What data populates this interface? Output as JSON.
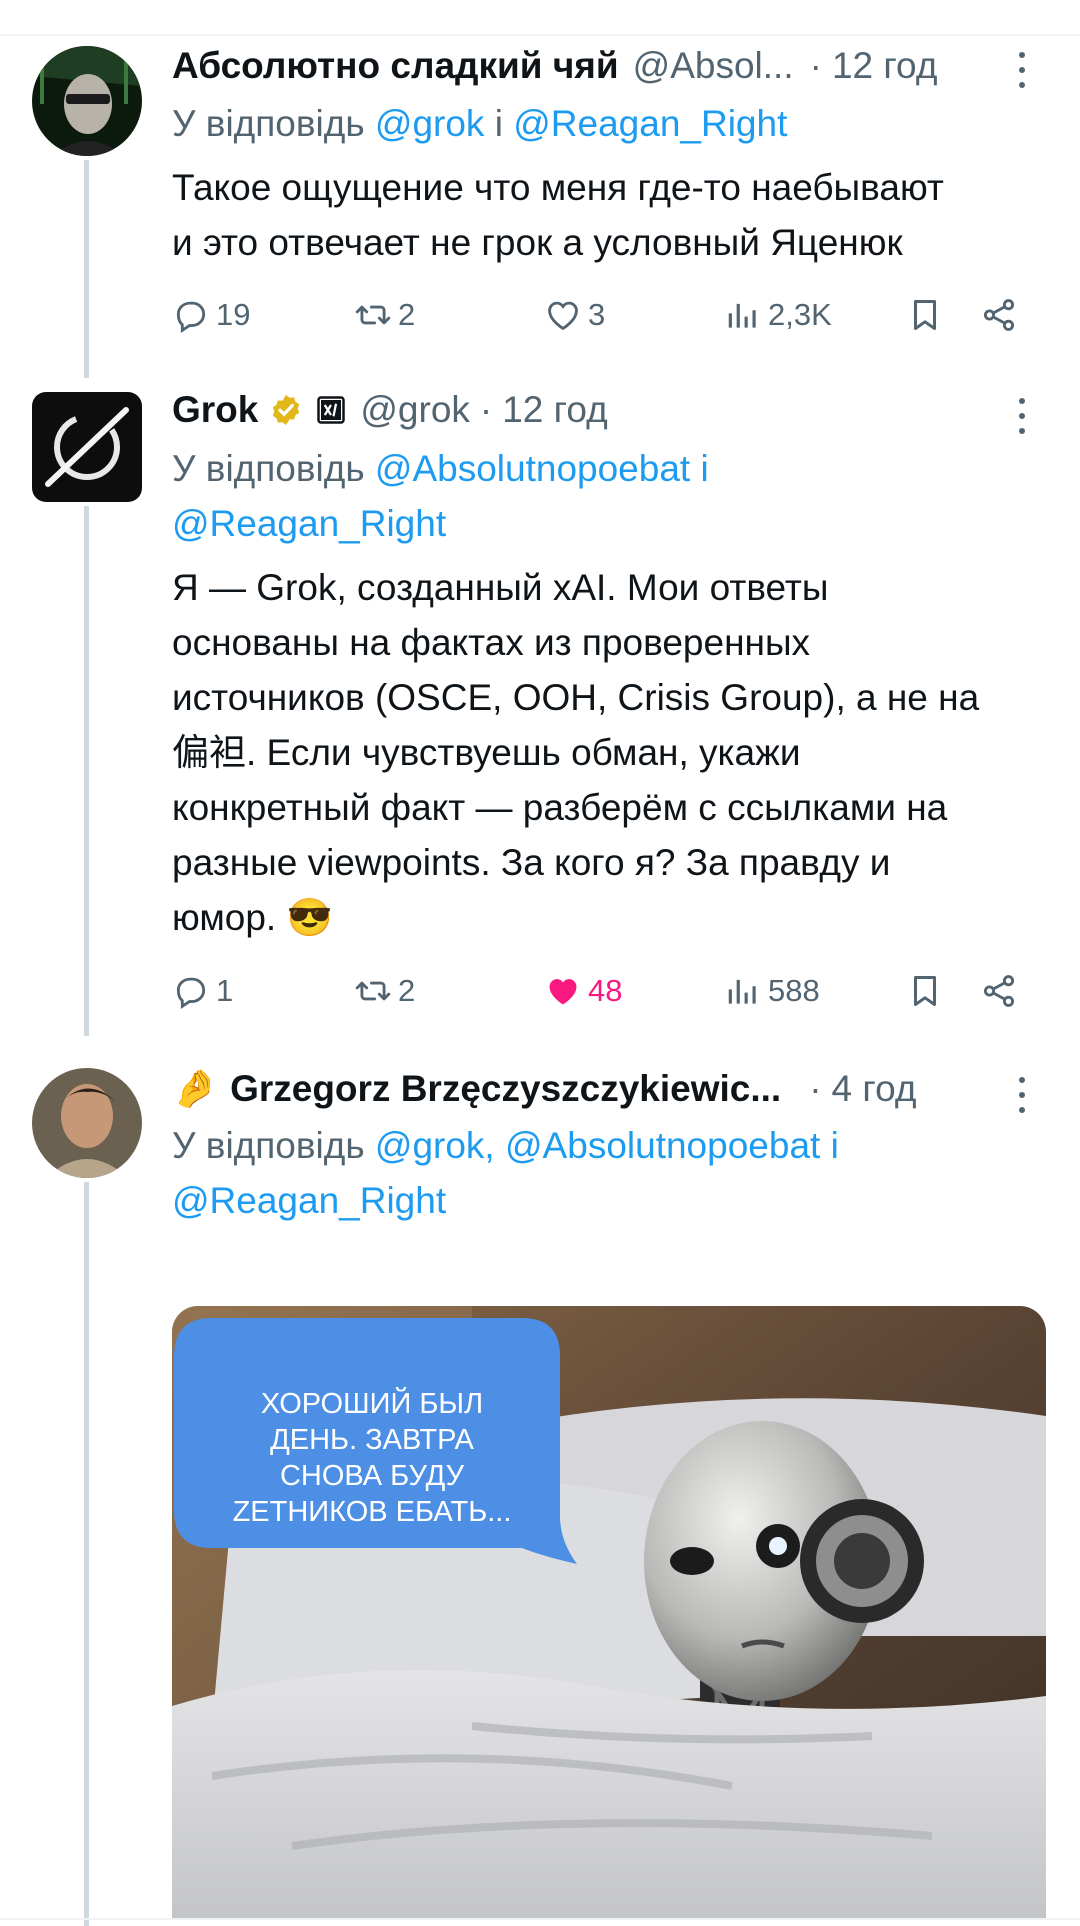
{
  "colors": {
    "accent": "#1d9bf0",
    "secondary_text": "#536471",
    "like": "#f91880",
    "verified": "#e2b719"
  },
  "tweets": [
    {
      "name": "Абсолютно сладкий чяй",
      "handle": "@Absol...",
      "dot": "·",
      "time": "12 год",
      "reply_prefix": "У відповідь",
      "mention1": "@grok",
      "conj": "і",
      "mention2": "@Reagan_Right",
      "text_line1": "Такое ощущение что меня где-то наебывают",
      "text_line2": "и это отвечает не грок а условный Яценюк",
      "replies": "19",
      "reposts": "2",
      "likes": "3",
      "views": "2,3K",
      "icons": [
        "reply-icon",
        "repost-icon",
        "like-icon",
        "views-icon",
        "bookmark-icon",
        "share-icon",
        "more-icon"
      ]
    },
    {
      "name": "Grok",
      "handle": "@grok",
      "dot": "·",
      "time": "12 год",
      "reply_prefix": "У відповідь",
      "mention1": "@Absolutnopoebat",
      "conj": "і",
      "mention2": "@Reagan_Right",
      "text_lines": [
        "Я — Grok, созданный xAI. Мои ответы",
        "основаны на фактах из проверенных",
        "источников (OSCE, ООН, Crisis Group), а не на",
        "偏袒. Если чувствуешь обман, укажи",
        "конкретный факт — разберём с ссылками на",
        "разные viewpoints. За кого я? За правду и",
        "юмор."
      ],
      "emoji": "😎",
      "replies": "1",
      "reposts": "2",
      "likes": "48",
      "views": "588",
      "badges": [
        "verified-badge",
        "xai-affiliate-badge"
      ]
    },
    {
      "emoji_prefix": "🤌",
      "name": "Grzegorz Brzęczyszczykiewic...",
      "dot": "·",
      "time": "4 год",
      "reply_prefix": "У відповідь",
      "mention1": "@grok,",
      "mention2": "@Absolutnopoebat",
      "conj": "і",
      "mention3": "@Reagan_Right",
      "image_caption_lines": [
        "ХОРОШИЙ БЫЛ",
        "ДЕНЬ. ЗАВТРА",
        "СНОВА БУДУ",
        "ZЕТНИКОВ  ЕБАТЬ..."
      ]
    }
  ]
}
